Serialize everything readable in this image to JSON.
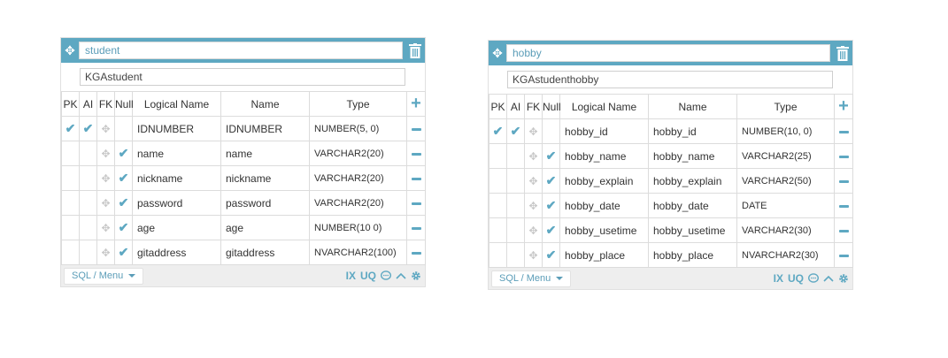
{
  "columns_header": {
    "pk": "PK",
    "ai": "AI",
    "fk": "FK",
    "null": "Null",
    "logical": "Logical Name",
    "name": "Name",
    "type": "Type"
  },
  "footer": {
    "menu_label": "SQL / Menu",
    "ix": "IX",
    "uq": "UQ"
  },
  "tables": [
    {
      "name": "student",
      "logical": "KGAstudent",
      "rows": [
        {
          "pk": true,
          "ai": true,
          "fk": false,
          "null": false,
          "logical": "IDNUMBER",
          "name": "IDNUMBER",
          "type": "NUMBER(5, 0)"
        },
        {
          "pk": false,
          "ai": false,
          "fk": false,
          "null": true,
          "logical": "name",
          "name": "name",
          "type": "VARCHAR2(20)"
        },
        {
          "pk": false,
          "ai": false,
          "fk": false,
          "null": true,
          "logical": "nickname",
          "name": "nickname",
          "type": "VARCHAR2(20)"
        },
        {
          "pk": false,
          "ai": false,
          "fk": false,
          "null": true,
          "logical": "password",
          "name": "password",
          "type": "VARCHAR2(20)"
        },
        {
          "pk": false,
          "ai": false,
          "fk": false,
          "null": true,
          "logical": "age",
          "name": "age",
          "type": "NUMBER(10 0)"
        },
        {
          "pk": false,
          "ai": false,
          "fk": false,
          "null": true,
          "logical": "gitaddress",
          "name": "gitaddress",
          "type": "NVARCHAR2(100)"
        }
      ]
    },
    {
      "name": "hobby",
      "logical": "KGAstudenthobby",
      "rows": [
        {
          "pk": true,
          "ai": true,
          "fk": false,
          "null": false,
          "logical": "hobby_id",
          "name": "hobby_id",
          "type": "NUMBER(10, 0)"
        },
        {
          "pk": false,
          "ai": false,
          "fk": false,
          "null": true,
          "logical": "hobby_name",
          "name": "hobby_name",
          "type": "VARCHAR2(25)"
        },
        {
          "pk": false,
          "ai": false,
          "fk": false,
          "null": true,
          "logical": "hobby_explain",
          "name": "hobby_explain",
          "type": "VARCHAR2(50)"
        },
        {
          "pk": false,
          "ai": false,
          "fk": false,
          "null": true,
          "logical": "hobby_date",
          "name": "hobby_date",
          "type": "DATE"
        },
        {
          "pk": false,
          "ai": false,
          "fk": false,
          "null": true,
          "logical": "hobby_usetime",
          "name": "hobby_usetime",
          "type": "VARCHAR2(30)"
        },
        {
          "pk": false,
          "ai": false,
          "fk": false,
          "null": true,
          "logical": "hobby_place",
          "name": "hobby_place",
          "type": "NVARCHAR2(30)"
        }
      ]
    }
  ],
  "colors": {
    "accent": "#5ea8c2",
    "footer_bg": "#eeeeee",
    "border": "#dcdcdc"
  }
}
